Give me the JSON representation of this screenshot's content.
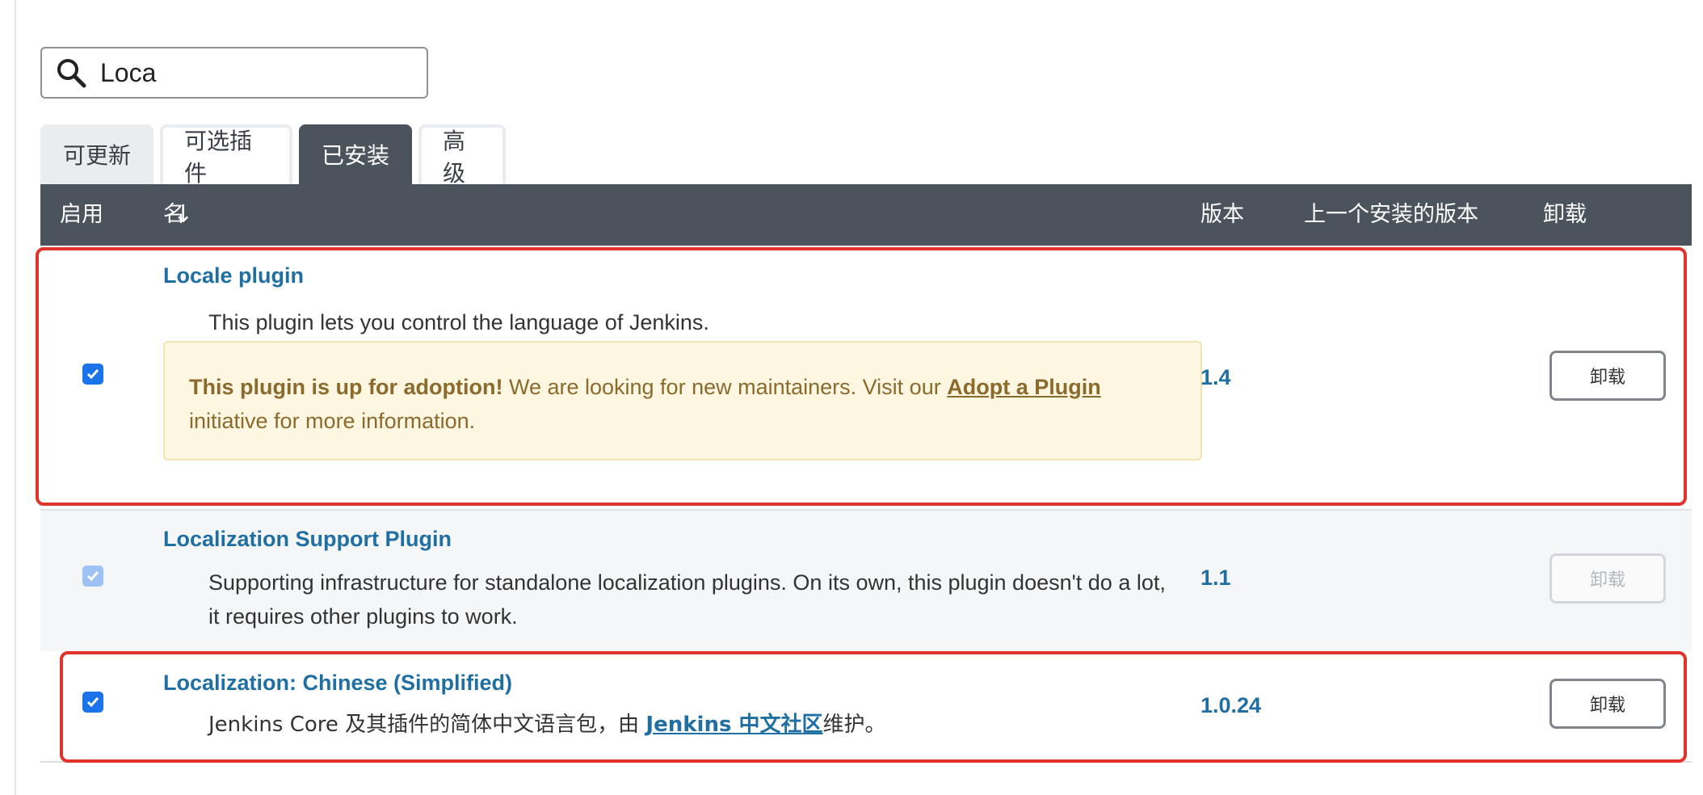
{
  "search": {
    "value": "Loca"
  },
  "tabs": [
    {
      "label": "可更新",
      "active": false
    },
    {
      "label": "可选插件",
      "active": false
    },
    {
      "label": "已安装",
      "active": true
    },
    {
      "label": "高级",
      "active": false
    }
  ],
  "table": {
    "headers": {
      "enabled": "启用",
      "name": "名称",
      "sort_indicator": "↓",
      "version": "版本",
      "previous_version": "上一个安装的版本",
      "uninstall": "卸载"
    },
    "rows": [
      {
        "name": "Locale plugin",
        "description": "This plugin lets you control the language of Jenkins.",
        "adoption": {
          "bold": "This plugin is up for adoption!",
          "text": " We are looking for new maintainers. Visit our ",
          "link": "Adopt a Plugin",
          "tail": " initiative for more information."
        },
        "version": "1.4",
        "enabled": true,
        "checkbox_disabled": false,
        "uninstall_label": "卸载",
        "uninstall_disabled": false
      },
      {
        "name": "Localization Support Plugin",
        "description": "Supporting infrastructure for standalone localization plugins. On its own, this plugin doesn't do a lot, it requires other plugins to work.",
        "version": "1.1",
        "enabled": true,
        "checkbox_disabled": true,
        "uninstall_label": "卸载",
        "uninstall_disabled": true
      },
      {
        "name": "Localization: Chinese (Simplified)",
        "description_prefix": "Jenkins Core 及其插件的简体中文语言包，由 ",
        "description_link": "Jenkins 中文社区",
        "description_suffix": "维护。",
        "version": "1.0.24",
        "enabled": true,
        "checkbox_disabled": false,
        "uninstall_label": "卸载",
        "uninstall_disabled": false
      }
    ]
  },
  "colors": {
    "header_bg": "#4b535d",
    "link_blue": "#1f6fa3",
    "adoption_bg": "#fdf6e0",
    "highlight_red": "#e0332c",
    "checkbox_blue": "#1a73e8"
  }
}
